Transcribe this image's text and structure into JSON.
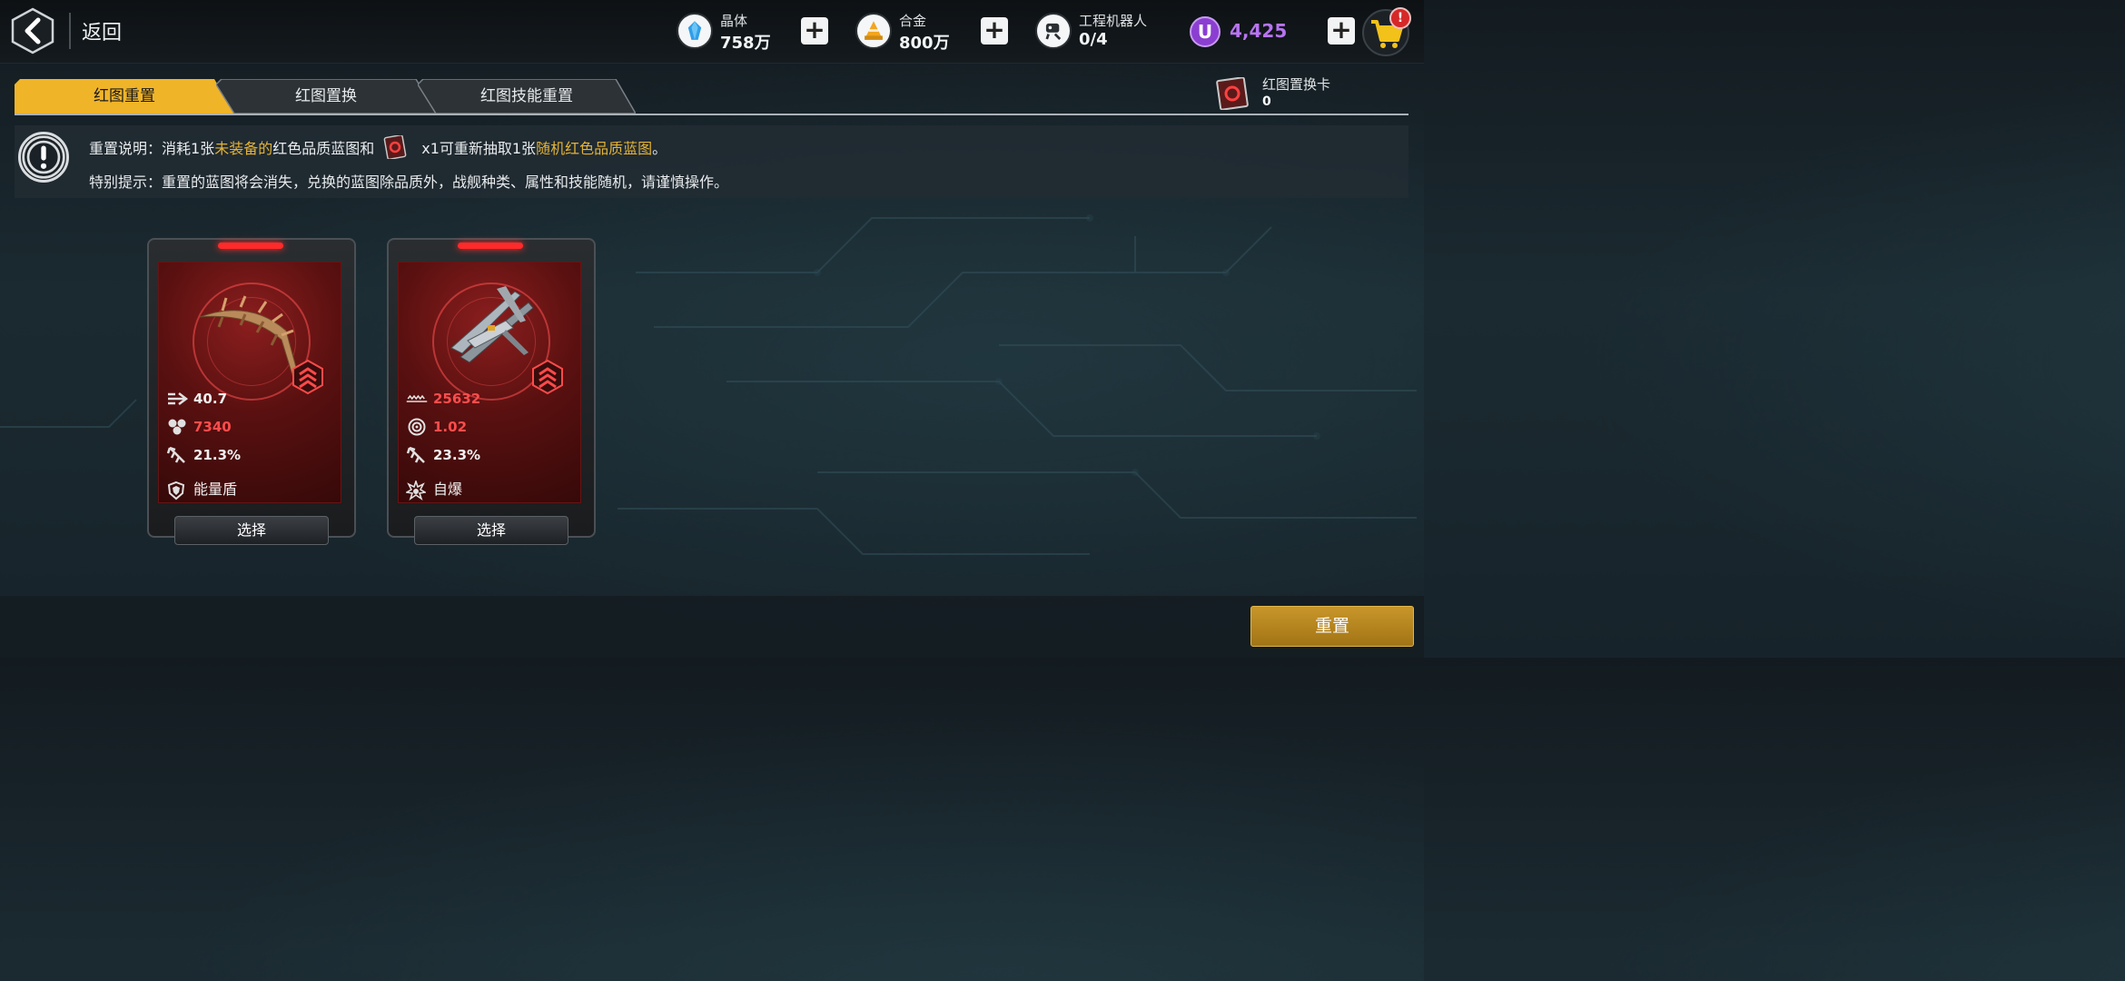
{
  "header": {
    "back_label": "返回",
    "resources": [
      {
        "name": "晶体",
        "value": "758万",
        "icon": "crystal-icon"
      },
      {
        "name": "合金",
        "value": "800万",
        "icon": "alloy-icon"
      },
      {
        "name": "工程机器人",
        "value": "0/4",
        "icon": "robot-icon"
      }
    ],
    "premium_currency": {
      "symbol": "U",
      "value": "4,425"
    },
    "cart_badge": "!"
  },
  "tabs": [
    {
      "label": "红图重置",
      "active": true
    },
    {
      "label": "红图置换",
      "active": false
    },
    {
      "label": "红图技能重置",
      "active": false
    }
  ],
  "card_counter": {
    "label": "红图置换卡",
    "value": "0"
  },
  "notice": {
    "line1_prefix": "重置说明：消耗1张",
    "line1_highlight1": "未装备的",
    "line1_mid": "红色品质蓝图和",
    "line1_qty": "x1可重新抽取1张",
    "line1_highlight2": "随机红色品质蓝图",
    "line1_end": "。",
    "line2": "特别提示：重置的蓝图将会消失，兑换的蓝图除品质外，战舰种类、属性和技能随机，请谨慎操作。"
  },
  "blueprints": [
    {
      "stats": [
        {
          "icon": "speed-icon",
          "value": "40.7"
        },
        {
          "icon": "hexagon-icon",
          "value": "7340"
        },
        {
          "icon": "missile-icon",
          "value": "21.3%"
        }
      ],
      "skill": {
        "icon": "shield-icon",
        "label": "能量盾"
      },
      "select_label": "选择"
    },
    {
      "stats": [
        {
          "icon": "wave-icon",
          "value": "25632"
        },
        {
          "icon": "target-icon",
          "value": "1.02"
        },
        {
          "icon": "missile-icon",
          "value": "23.3%"
        }
      ],
      "skill": {
        "icon": "explosion-icon",
        "label": "自爆"
      },
      "select_label": "选择"
    }
  ],
  "reset_button": "重置",
  "colors": {
    "accent_gold": "#e3b336",
    "stat_red": "#ff4d4d",
    "premium_purple": "#b774f0"
  }
}
